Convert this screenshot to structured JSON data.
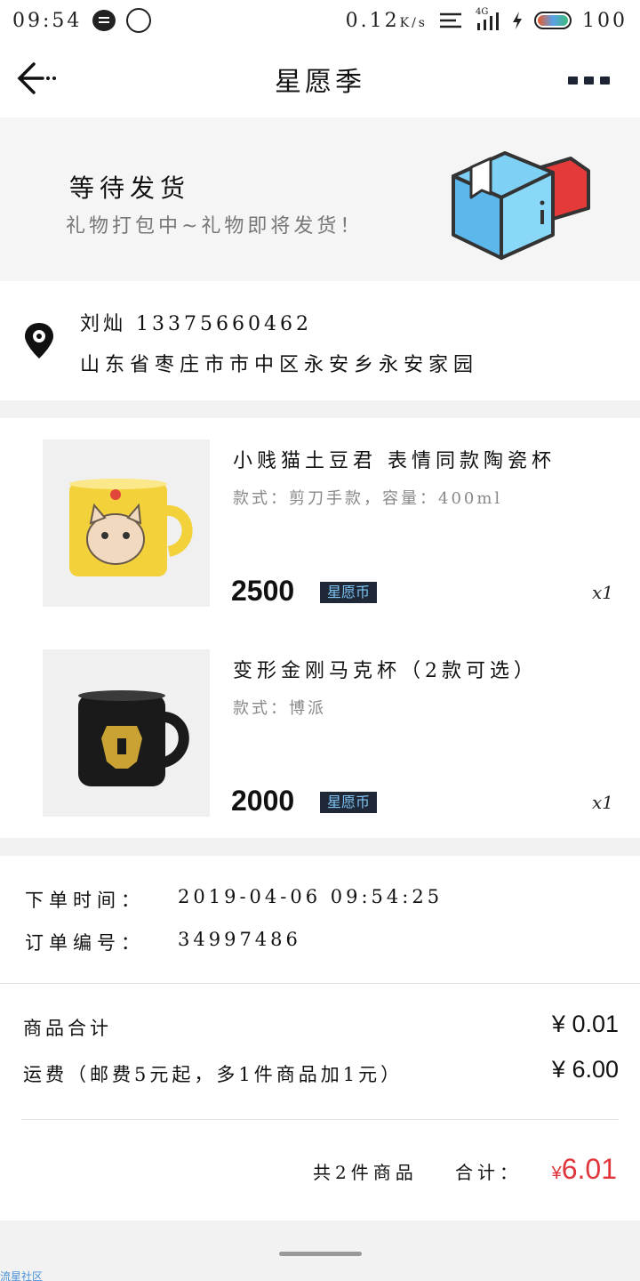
{
  "status_bar": {
    "time": "09:54",
    "net_speed": "0.12",
    "net_unit": "K/s",
    "signal": "4G",
    "battery": "100"
  },
  "nav": {
    "title": "星愿季"
  },
  "status_banner": {
    "title": "等待发货",
    "subtitle": "礼物打包中~礼物即将发货！"
  },
  "address": {
    "name_phone": "刘灿  13375660462",
    "line": "山东省枣庄市市中区永安乡永安家园"
  },
  "products": [
    {
      "title": "小贱猫土豆君 表情同款陶瓷杯",
      "spec": "款式：剪刀手款，容量：400ml",
      "price": "2500",
      "currency": "星愿币",
      "qty": "x1",
      "mug_color": "#f2d13a"
    },
    {
      "title": "变形金刚马克杯（2款可选）",
      "spec": "款式：博派",
      "price": "2000",
      "currency": "星愿币",
      "qty": "x1",
      "mug_color": "#1a1a1a"
    }
  ],
  "order_info": {
    "time_label": "下单时间：",
    "time_value": "2019-04-06 09:54:25",
    "no_label": "订单编号：",
    "no_value": "34997486"
  },
  "summary": {
    "goods_label": "商品合计",
    "goods_value": "¥ 0.01",
    "shipping_label": "运费（邮费5元起，多1件商品加1元）",
    "shipping_value": "¥ 6.00",
    "count_text": "共2件商品",
    "total_label": "合计：",
    "total_symbol": "¥",
    "total_value": "6.01",
    "accent_color": "#e0363b"
  },
  "watermark": "流星社区"
}
